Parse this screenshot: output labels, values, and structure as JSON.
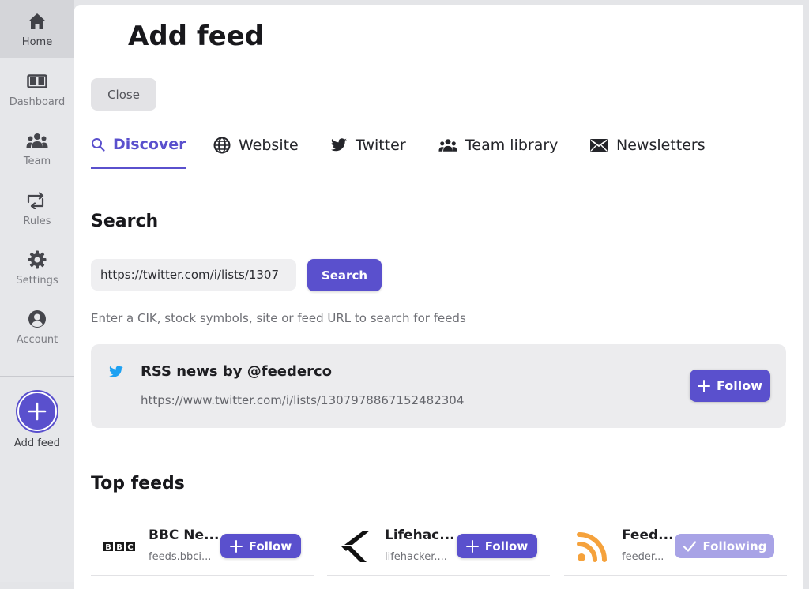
{
  "sidebar": {
    "items": [
      {
        "label": "Home",
        "icon": "home-icon",
        "active": true
      },
      {
        "label": "Dashboard",
        "icon": "dashboard-icon"
      },
      {
        "label": "Team",
        "icon": "team-icon"
      },
      {
        "label": "Rules",
        "icon": "rules-icon"
      },
      {
        "label": "Settings",
        "icon": "gear-icon"
      },
      {
        "label": "Account",
        "icon": "account-icon"
      }
    ],
    "add_feed_label": "Add feed"
  },
  "page": {
    "title": "Add feed",
    "close_label": "Close"
  },
  "tabs": [
    {
      "label": "Discover",
      "icon": "search-icon",
      "active": true
    },
    {
      "label": "Website",
      "icon": "globe-icon"
    },
    {
      "label": "Twitter",
      "icon": "twitter-icon"
    },
    {
      "label": "Team library",
      "icon": "team-icon"
    },
    {
      "label": "Newsletters",
      "icon": "envelope-icon"
    }
  ],
  "search": {
    "title": "Search",
    "value": "https://twitter.com/i/lists/1307",
    "button_label": "Search",
    "hint": "Enter a CIK, stock symbols, site or feed URL to search for feeds"
  },
  "result": {
    "name": "RSS news by @feederco",
    "url": "https://www.twitter.com/i/lists/1307978867152482304",
    "follow_label": "Follow"
  },
  "top_feeds": {
    "title": "Top feeds",
    "items": [
      {
        "name": "BBC Ne...",
        "domain": "feeds.bbci...",
        "action": "Follow",
        "logo": "bbc-logo"
      },
      {
        "name": "Lifehac...",
        "domain": "lifehacker....",
        "action": "Follow",
        "logo": "lifehacker-logo"
      },
      {
        "name": "Feed...",
        "domain": "feeder...",
        "action": "Following",
        "logo": "rss-logo"
      }
    ]
  },
  "colors": {
    "accent": "#5a50cd",
    "accent_light": "#a8a3e6",
    "twitter_blue": "#1da1f2",
    "rss_orange": "#f5a23c"
  }
}
